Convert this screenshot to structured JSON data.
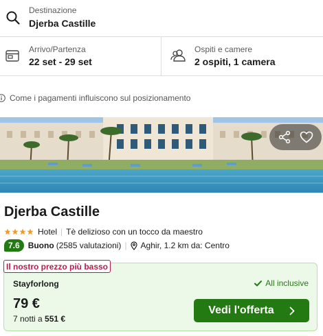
{
  "search": {
    "destination": {
      "label": "Destinazione",
      "value": "Djerba Castille"
    },
    "dates": {
      "label": "Arrivo/Partenza",
      "value": "22 set - 29 set"
    },
    "guests": {
      "label": "Ospiti e camere",
      "value": "2 ospiti, 1 camera"
    }
  },
  "info_notice": "Come i pagamenti influiscono sul posizionamento",
  "hotel": {
    "name": "Djerba Castille",
    "stars": 4,
    "type": "Hotel",
    "tagline": "Tè delizioso con un tocco da maestro",
    "rating_score": "7.6",
    "rating_word": "Buono",
    "rating_count": "(2585 valutazioni)",
    "location": "Aghir, 1.2 km da: Centro"
  },
  "deal": {
    "badge": "Il nostro prezzo più basso",
    "provider": "Stayforlong",
    "board": "All inclusive",
    "price": "79 €",
    "nights_prefix": "7 notti a",
    "total": "551 €",
    "cta_label": "Vedi l'offerta"
  },
  "colors": {
    "accent_green": "#247a12",
    "badge_red": "#b81b4a",
    "deal_bg": "#ecf8e8",
    "star_orange": "#f59a1d"
  },
  "icons": {
    "destination": "search-icon",
    "dates": "calendar-icon",
    "guests": "users-icon",
    "info": "info-icon",
    "share": "share-icon",
    "favorite": "heart-icon",
    "location": "map-pin-icon",
    "board": "check-icon",
    "cta": "chevron-right-icon"
  }
}
